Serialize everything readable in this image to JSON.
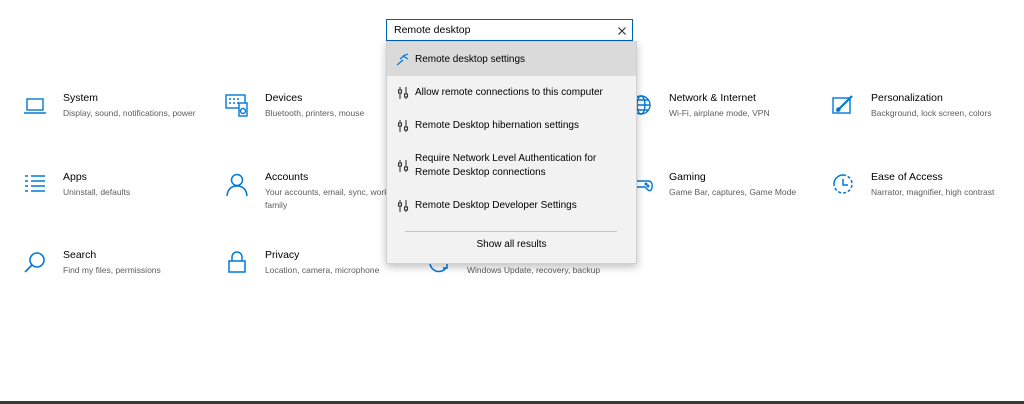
{
  "search": {
    "value": "Remote desktop",
    "results": [
      {
        "label": "Remote desktop settings",
        "icon": "remote-desktop-icon"
      },
      {
        "label": "Allow remote connections to this computer",
        "icon": "settings-sliders-icon"
      },
      {
        "label": "Remote Desktop hibernation settings",
        "icon": "settings-sliders-icon"
      },
      {
        "label": "Require Network Level Authentication for Remote Desktop connections",
        "icon": "settings-sliders-icon"
      },
      {
        "label": "Remote Desktop Developer Settings",
        "icon": "settings-sliders-icon"
      }
    ],
    "show_all_label": "Show all results"
  },
  "tiles": {
    "system": {
      "title": "System",
      "desc": "Display, sound, notifications, power",
      "icon": "laptop-icon"
    },
    "devices": {
      "title": "Devices",
      "desc": "Bluetooth, printers, mouse",
      "icon": "keyboard-speaker-icon"
    },
    "network": {
      "title": "Network & Internet",
      "desc": "Wi-Fi, airplane mode, VPN",
      "icon": "globe-icon"
    },
    "personalization": {
      "title": "Personalization",
      "desc": "Background, lock screen, colors",
      "icon": "paint-brush-icon"
    },
    "apps": {
      "title": "Apps",
      "desc": "Uninstall, defaults",
      "icon": "apps-list-icon"
    },
    "accounts": {
      "title": "Accounts",
      "desc": "Your accounts, email, sync, work, family",
      "icon": "person-icon"
    },
    "gaming": {
      "title": "Gaming",
      "desc": "Game Bar, captures, Game Mode",
      "icon": "gamepad-icon"
    },
    "ease": {
      "title": "Ease of Access",
      "desc": "Narrator, magnifier, high contrast",
      "icon": "ease-of-access-icon"
    },
    "search": {
      "title": "Search",
      "desc": "Find my files, permissions",
      "icon": "magnifier-icon"
    },
    "privacy": {
      "title": "Privacy",
      "desc": "Location, camera, microphone",
      "icon": "lock-icon"
    },
    "update": {
      "desc": "Windows Update, recovery, backup",
      "icon": "sync-icon"
    }
  },
  "colors": {
    "accent": "#0063b1",
    "icon_blue": "#0078d7",
    "dropdown_bg": "#f2f2f2",
    "highlight": "#dadada"
  }
}
